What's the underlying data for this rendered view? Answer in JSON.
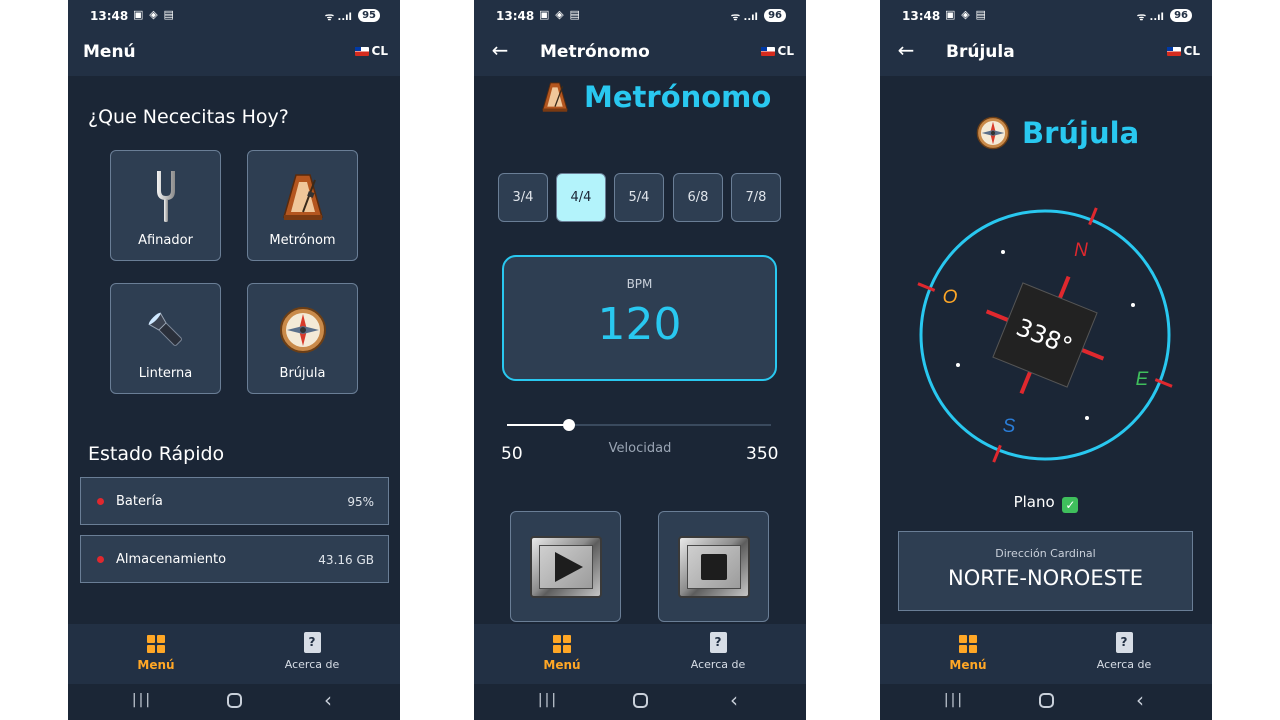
{
  "status_bar": {
    "time": "13:48",
    "screens": [
      {
        "battery": "95"
      },
      {
        "battery": "96"
      },
      {
        "battery": "96"
      }
    ]
  },
  "lang": "CL",
  "menu_screen": {
    "title": "Menú",
    "heading": "¿Que Nececitas Hoy?",
    "tiles": [
      {
        "label": "Afinador",
        "icon": "tuning-fork-icon"
      },
      {
        "label": "Metrónom",
        "icon": "metronome-icon"
      },
      {
        "label": "Linterna",
        "icon": "flashlight-icon"
      },
      {
        "label": "Brújula",
        "icon": "compass-icon"
      }
    ],
    "status_heading": "Estado Rápido",
    "status_items": [
      {
        "label": "Batería",
        "value": "95%"
      },
      {
        "label": "Almacenamiento",
        "value": "43.16 GB"
      }
    ]
  },
  "metronome_screen": {
    "appbar_title": "Metrónomo",
    "title": "Metrónomo",
    "time_signatures": [
      "3/4",
      "4/4",
      "5/4",
      "6/8",
      "7/8"
    ],
    "selected_signature": "4/4",
    "bpm_label": "BPM",
    "bpm_value": "120",
    "slider": {
      "min": "50",
      "max": "350",
      "label": "Velocidad",
      "value": 120
    }
  },
  "compass_screen": {
    "appbar_title": "Brújula",
    "title": "Brújula",
    "heading_degrees": "338°",
    "cardinals": {
      "n": "N",
      "e": "E",
      "s": "S",
      "o": "O"
    },
    "plano_label": "Plano",
    "direction_label": "Dirección Cardinal",
    "direction_value": "NORTE-NOROESTE"
  },
  "bottom_nav": {
    "menu": "Menú",
    "about": "Acerca de"
  },
  "colors": {
    "accent": "#29c8f0",
    "nav_active": "#ffa726",
    "background": "#1b2636",
    "indicator_red": "#e0282e"
  }
}
